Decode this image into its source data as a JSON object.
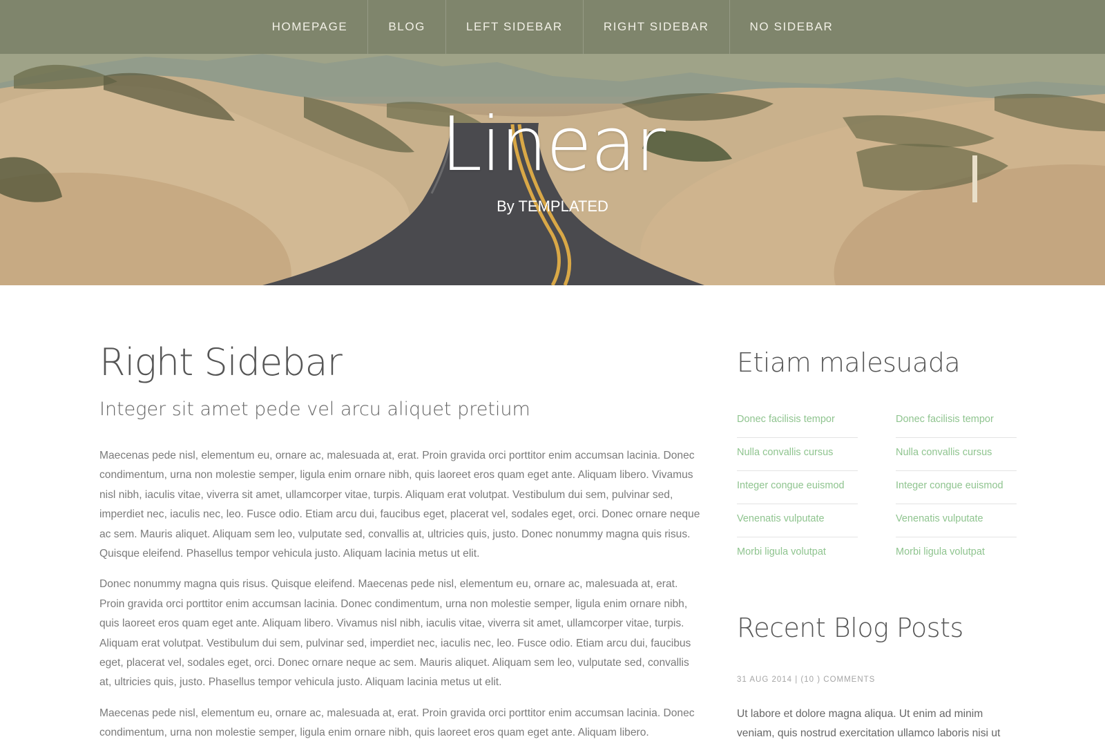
{
  "nav": {
    "items": [
      {
        "label": "HOMEPAGE"
      },
      {
        "label": "BLOG"
      },
      {
        "label": "LEFT SIDEBAR"
      },
      {
        "label": "RIGHT SIDEBAR"
      },
      {
        "label": "NO SIDEBAR"
      }
    ]
  },
  "hero": {
    "title": "Linear",
    "byline": "By TEMPLATED",
    "background_image": "desert-road-photo"
  },
  "main": {
    "title": "Right Sidebar",
    "subtitle": "Integer sit amet pede vel arcu aliquet pretium",
    "paragraphs": [
      "Maecenas pede nisl, elementum eu, ornare ac, malesuada at, erat. Proin gravida orci porttitor enim accumsan lacinia. Donec condimentum, urna non molestie semper, ligula enim ornare nibh, quis laoreet eros quam eget ante. Aliquam libero. Vivamus nisl nibh, iaculis vitae, viverra sit amet, ullamcorper vitae, turpis. Aliquam erat volutpat. Vestibulum dui sem, pulvinar sed, imperdiet nec, iaculis nec, leo. Fusce odio. Etiam arcu dui, faucibus eget, placerat vel, sodales eget, orci. Donec ornare neque ac sem. Mauris aliquet. Aliquam sem leo, vulputate sed, convallis at, ultricies quis, justo. Donec nonummy magna quis risus. Quisque eleifend. Phasellus tempor vehicula justo. Aliquam lacinia metus ut elit.",
      "Donec nonummy magna quis risus. Quisque eleifend. Maecenas pede nisl, elementum eu, ornare ac, malesuada at, erat. Proin gravida orci porttitor enim accumsan lacinia. Donec condimentum, urna non molestie semper, ligula enim ornare nibh, quis laoreet eros quam eget ante. Aliquam libero. Vivamus nisl nibh, iaculis vitae, viverra sit amet, ullamcorper vitae, turpis. Aliquam erat volutpat. Vestibulum dui sem, pulvinar sed, imperdiet nec, iaculis nec, leo. Fusce odio. Etiam arcu dui, faucibus eget, placerat vel, sodales eget, orci. Donec ornare neque ac sem. Mauris aliquet. Aliquam sem leo, vulputate sed, convallis at, ultricies quis, justo. Phasellus tempor vehicula justo. Aliquam lacinia metus ut elit.",
      "Maecenas pede nisl, elementum eu, ornare ac, malesuada at, erat. Proin gravida orci porttitor enim accumsan lacinia. Donec condimentum, urna non molestie semper, ligula enim ornare nibh, quis laoreet eros quam eget ante. Aliquam libero."
    ]
  },
  "sidebar": {
    "heading": "Etiam malesuada",
    "link_columns": [
      [
        "Donec facilisis tempor",
        "Nulla convallis cursus",
        "Integer congue euismod",
        "Venenatis vulputate",
        "Morbi ligula volutpat"
      ],
      [
        "Donec facilisis tempor",
        "Nulla convallis cursus",
        "Integer congue euismod",
        "Venenatis vulputate",
        "Morbi ligula volutpat"
      ]
    ],
    "recent_heading": "Recent Blog Posts",
    "post": {
      "meta": "31 AUG 2014 | (10 ) COMMENTS",
      "excerpt": "Ut labore et dolore magna aliqua. Ut enim ad minim veniam, quis nostrud exercitation ullamco laboris nisi ut"
    }
  },
  "colors": {
    "accent_link": "#8fc48f",
    "heading": "#555555",
    "body_text": "#7a7a7a",
    "nav_bar": "#6e7658"
  }
}
